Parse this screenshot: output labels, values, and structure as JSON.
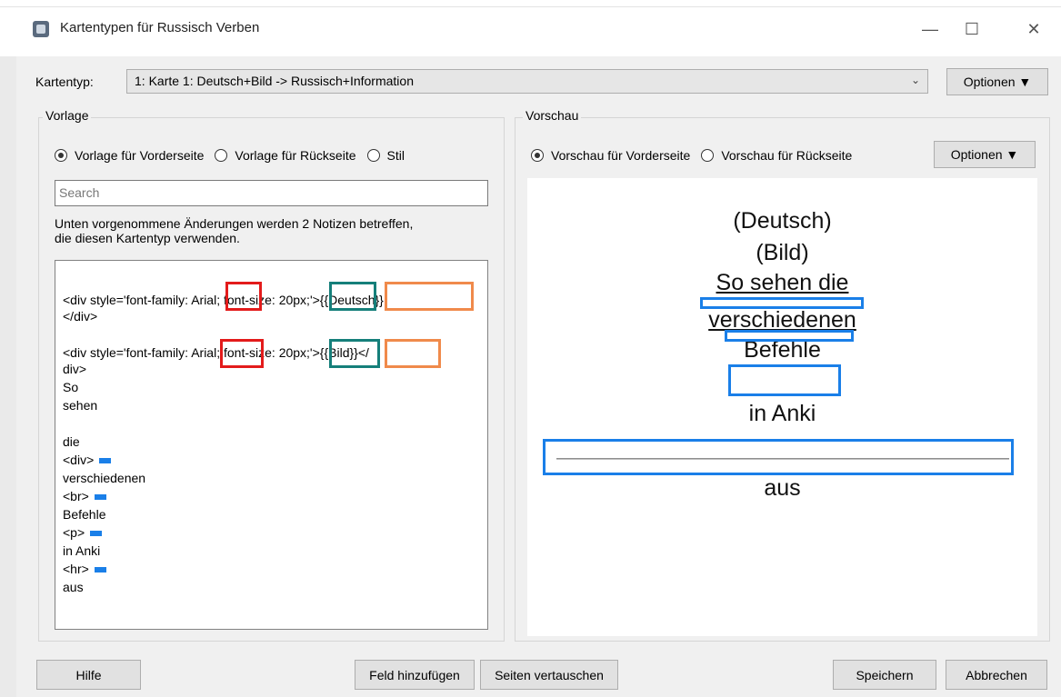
{
  "window": {
    "title": "Kartentypen für Russisch Verben",
    "minimize": "—",
    "maximize": "☐",
    "close": "✕"
  },
  "kartentyp": {
    "label": "Kartentyp:",
    "selected": "1: Karte 1: Deutsch+Bild -> Russisch+Information",
    "options_button": "Optionen ▼"
  },
  "vorlage": {
    "group_title": "Vorlage",
    "radio_front": "Vorlage für Vorderseite",
    "radio_back": "Vorlage für Rückseite",
    "radio_style": "Stil",
    "search_placeholder": "Search",
    "info_line1": "Unten vorgenommene Änderungen werden 2 Notizen betreffen,",
    "info_line2": "die diesen Kartentyp verwenden.",
    "code": {
      "l1a": "<div style='font-family: ",
      "l1_font": "Arial;",
      "l1b": " font-size: ",
      "l1_size": "20px;",
      "l1c": "'>",
      "l1_field": "{{Deutsch}}",
      "l2": "</div>",
      "l3a": "<div style='font-family: ",
      "l3_font": "Arial;",
      "l3b": " font-size: ",
      "l3_size": "20px;'",
      "l3c": ">",
      "l3_field": "{{Bild}}",
      "l3d": "</",
      "l4": "div>",
      "l5": "So",
      "l6": "sehen",
      "l7": "die",
      "l8": "<div>",
      "l9": "verschiedenen",
      "l10": "<br>",
      "l11": "Befehle",
      "l12": "<p>",
      "l13": "in Anki",
      "l14": "<hr>",
      "l15": "aus"
    }
  },
  "vorschau": {
    "group_title": "Vorschau",
    "radio_front": "Vorschau für Vorderseite",
    "radio_back": "Vorschau für Rückseite",
    "options_button": "Optionen ▼",
    "preview": {
      "deutsch": "(Deutsch)",
      "bild": "(Bild)",
      "line1": "So sehen die",
      "line2": "verschiedenen",
      "line3": "Befehle",
      "line4": "in Anki",
      "line5": "aus"
    }
  },
  "footer": {
    "help": "Hilfe",
    "add_field": "Feld hinzufügen",
    "swap_sides": "Seiten vertauschen",
    "save": "Speichern",
    "cancel": "Abbrechen"
  },
  "colors": {
    "highlight_red": "#e31b1b",
    "highlight_teal": "#157f7a",
    "highlight_orange": "#f08a4b",
    "highlight_blue": "#1a7fe8"
  }
}
